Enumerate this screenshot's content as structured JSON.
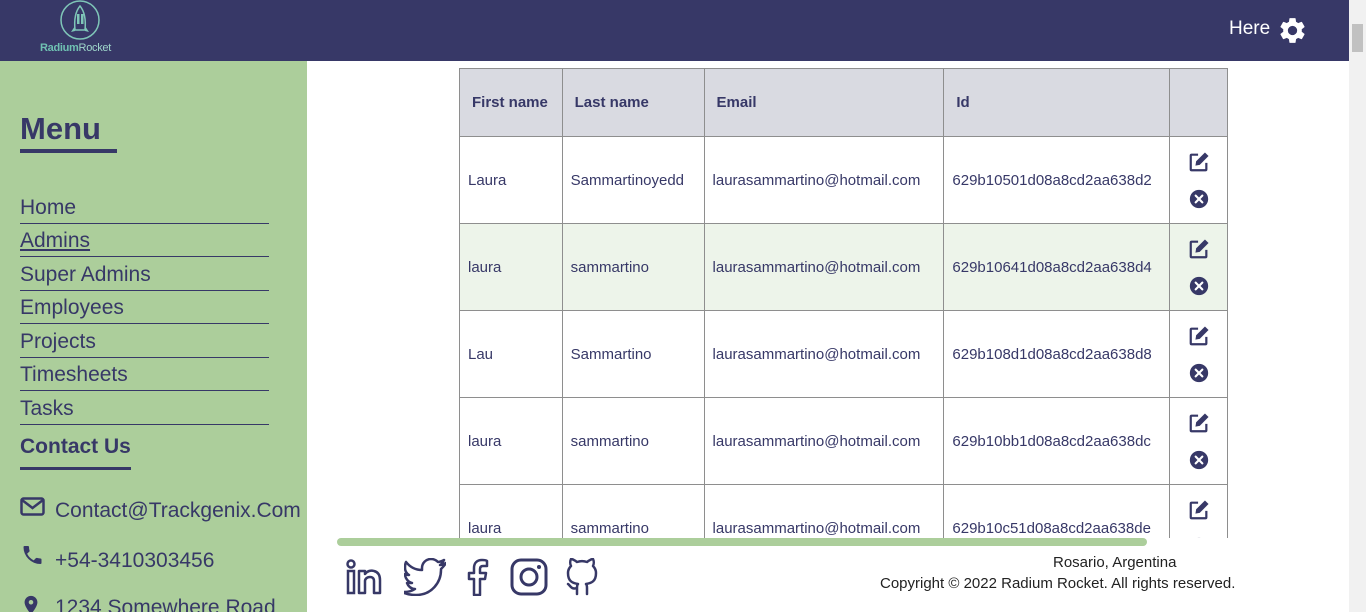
{
  "header": {
    "logo_word_bold": "Radium",
    "logo_word_light": "Rocket",
    "user_label": "Here",
    "settings_icon": "gear-icon",
    "bg_color": "#373867"
  },
  "sidebar": {
    "title": "Menu",
    "items": [
      {
        "label": "Home"
      },
      {
        "label": "Admins"
      },
      {
        "label": "Super Admins"
      },
      {
        "label": "Employees"
      },
      {
        "label": "Projects"
      },
      {
        "label": "Timesheets"
      },
      {
        "label": "Tasks"
      }
    ],
    "contact_title": "Contact Us",
    "contact": {
      "email": "Contact@Trackgenix.Com",
      "phone": "+54-3410303456",
      "address": "1234 Somewhere Road"
    },
    "bg_color": "#acce9b"
  },
  "table": {
    "headers": {
      "first_name": "First name",
      "last_name": "Last name",
      "email": "Email",
      "id": "Id"
    },
    "rows": [
      {
        "first_name": "Laura",
        "last_name": "Sammartinoyedd",
        "email": "laurasammartino@hotmail.com",
        "id": "629b10501d08a8cd2aa638d2"
      },
      {
        "first_name": "laura",
        "last_name": "sammartino",
        "email": "laurasammartino@hotmail.com",
        "id": "629b10641d08a8cd2aa638d4"
      },
      {
        "first_name": "Lau",
        "last_name": "Sammartino",
        "email": "laurasammartino@hotmail.com",
        "id": "629b108d1d08a8cd2aa638d8"
      },
      {
        "first_name": "laura",
        "last_name": "sammartino",
        "email": "laurasammartino@hotmail.com",
        "id": "629b10bb1d08a8cd2aa638dc"
      },
      {
        "first_name": "laura",
        "last_name": "sammartino",
        "email": "laurasammartino@hotmail.com",
        "id": "629b10c51d08a8cd2aa638de"
      }
    ],
    "row_actions": [
      "edit-icon",
      "delete-icon"
    ]
  },
  "footer": {
    "social_icons": [
      "linkedin-icon",
      "twitter-icon",
      "facebook-icon",
      "instagram-icon",
      "github-icon"
    ],
    "location": "Rosario, Argentina",
    "copyright": "Copyright © 2022 Radium Rocket. All rights reserved."
  }
}
